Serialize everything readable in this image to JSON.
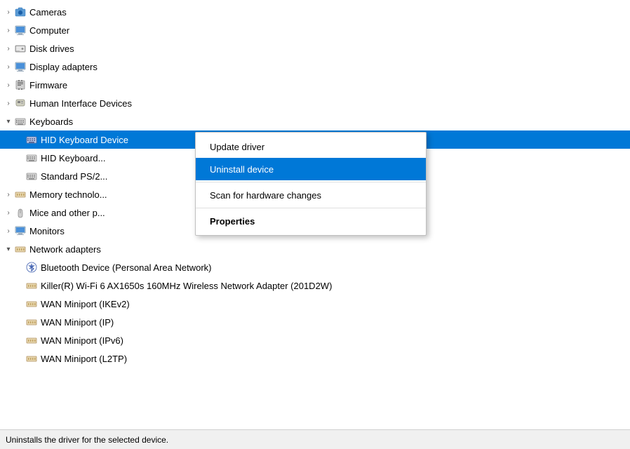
{
  "tree": {
    "items": [
      {
        "id": "cameras",
        "label": "Cameras",
        "level": 0,
        "expand": "collapsed",
        "icon": "camera",
        "state": "normal"
      },
      {
        "id": "computer",
        "label": "Computer",
        "level": 0,
        "expand": "collapsed",
        "icon": "computer",
        "state": "normal"
      },
      {
        "id": "disk-drives",
        "label": "Disk drives",
        "level": 0,
        "expand": "collapsed",
        "icon": "disk",
        "state": "normal"
      },
      {
        "id": "display-adapters",
        "label": "Display adapters",
        "level": 0,
        "expand": "collapsed",
        "icon": "display",
        "state": "normal"
      },
      {
        "id": "firmware",
        "label": "Firmware",
        "level": 0,
        "expand": "collapsed",
        "icon": "firmware",
        "state": "normal"
      },
      {
        "id": "human-interface",
        "label": "Human Interface Devices",
        "level": 0,
        "expand": "collapsed",
        "icon": "hid",
        "state": "normal"
      },
      {
        "id": "keyboards",
        "label": "Keyboards",
        "level": 0,
        "expand": "expanded",
        "icon": "keyboard",
        "state": "normal"
      },
      {
        "id": "hid-keyboard-1",
        "label": "HID Keyboard Device",
        "level": 1,
        "expand": "none",
        "icon": "keyboard",
        "state": "selected-blue"
      },
      {
        "id": "hid-keyboard-2",
        "label": "HID Keyboard...",
        "level": 1,
        "expand": "none",
        "icon": "keyboard",
        "state": "normal"
      },
      {
        "id": "standard-ps2",
        "label": "Standard PS/2...",
        "level": 1,
        "expand": "none",
        "icon": "keyboard",
        "state": "normal"
      },
      {
        "id": "memory-tech",
        "label": "Memory technolo...",
        "level": 0,
        "expand": "collapsed",
        "icon": "memory",
        "state": "normal"
      },
      {
        "id": "mice",
        "label": "Mice and other p...",
        "level": 0,
        "expand": "collapsed",
        "icon": "mouse",
        "state": "normal"
      },
      {
        "id": "monitors",
        "label": "Monitors",
        "level": 0,
        "expand": "collapsed",
        "icon": "monitor",
        "state": "normal"
      },
      {
        "id": "network-adapters",
        "label": "Network adapters",
        "level": 0,
        "expand": "expanded",
        "icon": "network",
        "state": "normal"
      },
      {
        "id": "bluetooth",
        "label": "Bluetooth Device (Personal Area Network)",
        "level": 1,
        "expand": "none",
        "icon": "bluetooth",
        "state": "normal"
      },
      {
        "id": "killer-wifi",
        "label": "Killer(R) Wi-Fi 6 AX1650s 160MHz Wireless Network Adapter (201D2W)",
        "level": 1,
        "expand": "none",
        "icon": "network-card",
        "state": "normal"
      },
      {
        "id": "wan-ikev2",
        "label": "WAN Miniport (IKEv2)",
        "level": 1,
        "expand": "none",
        "icon": "network-card",
        "state": "normal"
      },
      {
        "id": "wan-ip",
        "label": "WAN Miniport (IP)",
        "level": 1,
        "expand": "none",
        "icon": "network-card",
        "state": "normal"
      },
      {
        "id": "wan-ipv6",
        "label": "WAN Miniport (IPv6)",
        "level": 1,
        "expand": "none",
        "icon": "network-card",
        "state": "normal"
      },
      {
        "id": "wan-l2tp",
        "label": "WAN Miniport (L2TP)",
        "level": 1,
        "expand": "none",
        "icon": "network-card",
        "state": "normal"
      }
    ]
  },
  "context_menu": {
    "items": [
      {
        "id": "update-driver",
        "label": "Update driver",
        "bold": false,
        "highlighted": false
      },
      {
        "id": "uninstall-device",
        "label": "Uninstall device",
        "bold": false,
        "highlighted": true
      },
      {
        "id": "scan-hardware",
        "label": "Scan for hardware changes",
        "bold": false,
        "highlighted": false
      },
      {
        "id": "properties",
        "label": "Properties",
        "bold": true,
        "highlighted": false
      }
    ]
  },
  "status_bar": {
    "text": "Uninstalls the driver for the selected device."
  }
}
